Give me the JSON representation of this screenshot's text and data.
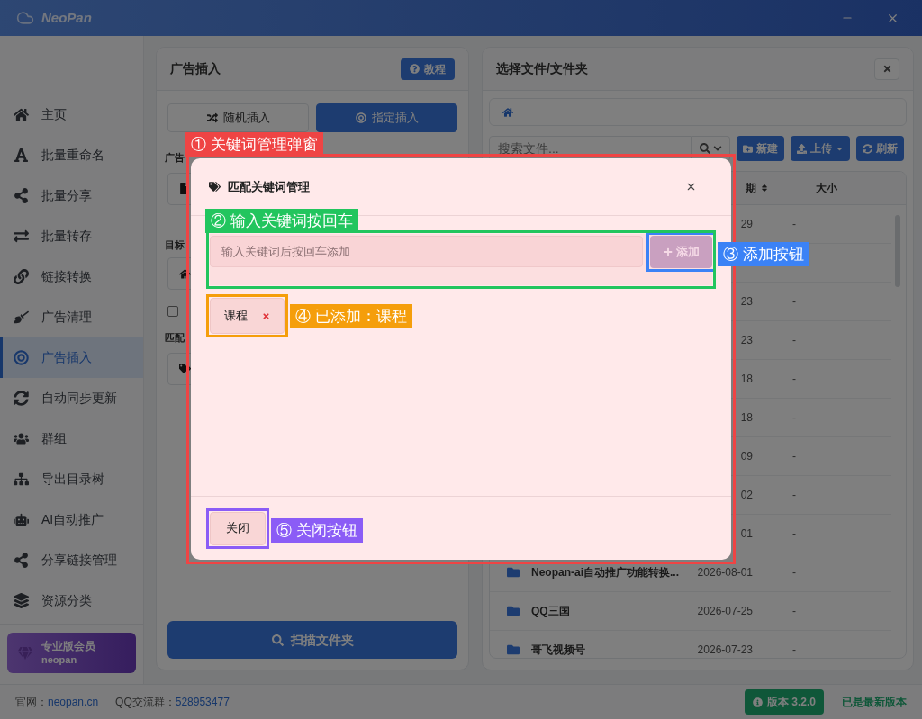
{
  "app": {
    "title": "NeoPan"
  },
  "sidebar": {
    "items": [
      {
        "label": "主页",
        "selected": false
      },
      {
        "label": "批量重命名",
        "selected": false
      },
      {
        "label": "批量分享",
        "selected": false
      },
      {
        "label": "批量转存",
        "selected": false
      },
      {
        "label": "链接转换",
        "selected": false
      },
      {
        "label": "广告清理",
        "selected": false
      },
      {
        "label": "广告插入",
        "selected": true
      },
      {
        "label": "自动同步更新",
        "selected": false
      },
      {
        "label": "群组",
        "selected": false
      },
      {
        "label": "导出目录树",
        "selected": false
      },
      {
        "label": "AI自动推广",
        "selected": false
      },
      {
        "label": "分享链接管理",
        "selected": false
      },
      {
        "label": "资源分类",
        "selected": false
      }
    ],
    "pro_card": {
      "title": "专业版会员",
      "subtitle": "neopan"
    }
  },
  "ad_panel": {
    "title": "广告插入",
    "help_button": "教程",
    "tabs": [
      {
        "label": "随机插入",
        "selected": false
      },
      {
        "label": "指定插入",
        "selected": true
      }
    ],
    "section_1_label": "广告",
    "section_2_label": "目标",
    "checkbox": {
      "checked": false
    },
    "section_3_label": "匹配",
    "scan_button": "扫描文件夹"
  },
  "file_panel": {
    "title": "选择文件/文件夹",
    "search": {
      "placeholder": "搜索文件..."
    },
    "buttons": [
      {
        "label": "新建",
        "kind": "new"
      },
      {
        "label": "上传",
        "kind": "upload"
      },
      {
        "label": "刷新",
        "kind": "refresh"
      }
    ],
    "table": {
      "columns": [
        {
          "label": "期",
          "sortable": true
        },
        {
          "label": "大小",
          "sortable": false
        }
      ],
      "rows": [
        {
          "date": "29",
          "size": "-"
        },
        {},
        {
          "date": "23",
          "size": "-"
        },
        {
          "date": "23",
          "size": "-"
        },
        {
          "date": "18",
          "size": "-"
        },
        {
          "date": "18",
          "size": "-"
        },
        {
          "date": "09",
          "size": "-"
        },
        {
          "date": "02",
          "size": "-"
        },
        {
          "date": "01",
          "size": "-"
        },
        {
          "name": "Neopan-ai自动推广功能转换...",
          "date": "2026-08-01",
          "size": "-"
        },
        {
          "name": "QQ三国",
          "date": "2026-07-25",
          "size": "-"
        },
        {
          "name": "哥飞视频号",
          "date": "2026-07-23",
          "size": "-"
        }
      ]
    }
  },
  "dialog": {
    "title": "匹配关键词管理",
    "annotation": {
      "label": "① 关键词管理弹窗",
      "color": "#ef4444"
    },
    "input": {
      "placeholder": "输入关键词后按回车添加",
      "annotation": {
        "label": "② 输入关键词按回车",
        "color": "#22c55e"
      }
    },
    "add_button": {
      "label": "添加",
      "disabled": true,
      "annotation": {
        "label": "③ 添加按钮",
        "color": "#3b82f6"
      }
    },
    "tags": [
      {
        "label": "课程",
        "annotation": {
          "label": "④ 已添加：课程",
          "color": "#f59e0b"
        }
      }
    ],
    "close_button": {
      "label": "关闭",
      "annotation": {
        "label": "⑤ 关闭按钮",
        "color": "#8b5cf6"
      }
    }
  },
  "status_bar": {
    "site_label": "官网：",
    "site_link": "neopan.cn",
    "qq_label": "QQ交流群：",
    "qq_number": "528953477",
    "version": "版本 3.2.0",
    "update_status": "已是最新版本"
  }
}
